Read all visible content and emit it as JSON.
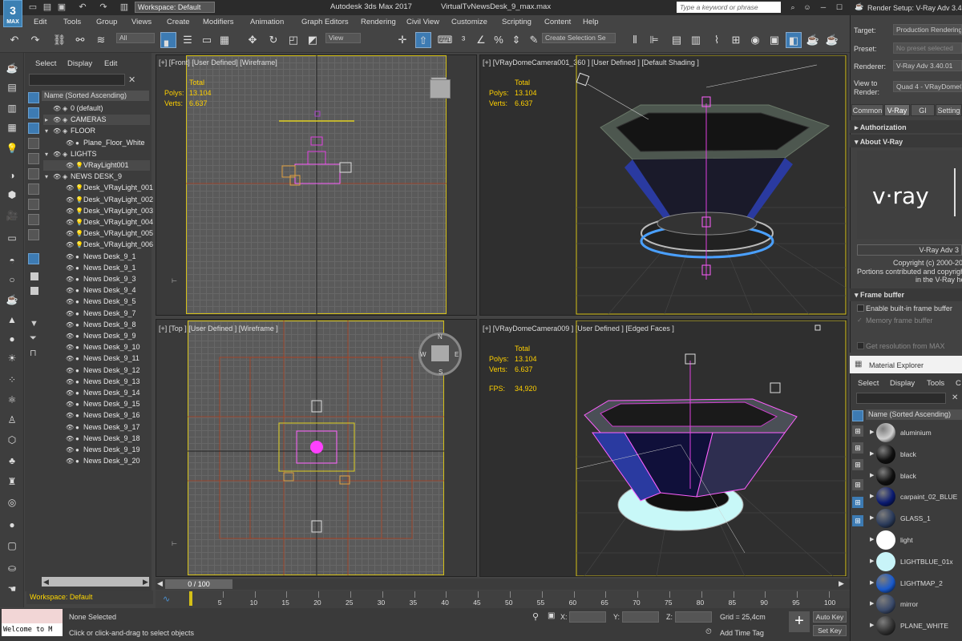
{
  "app": {
    "title": "Autodesk 3ds Max 2017",
    "file": "VirtualTvNewsDesk_9_max.max",
    "logo": "3",
    "logo_sub": "MAX",
    "workspace": "Workspace: Default",
    "search_placeholder": "Type a keyword or phrase"
  },
  "menu": [
    "Edit",
    "Tools",
    "Group",
    "Views",
    "Create",
    "Modifiers",
    "Animation",
    "Graph Editors",
    "Rendering",
    "Civil View",
    "Customize",
    "Scripting",
    "Content",
    "Help"
  ],
  "toolbar": {
    "filter": "All",
    "view": "View",
    "selection_set": "Create Selection Se"
  },
  "scene_explorer": {
    "tabs": [
      "Select",
      "Display",
      "Edit"
    ],
    "header": "Name (Sorted Ascending)",
    "rows": [
      {
        "label": "0 (default)",
        "indent": 1,
        "group": false,
        "icon": "layer"
      },
      {
        "label": "CAMERAS",
        "indent": 1,
        "group": true,
        "icon": "layer"
      },
      {
        "label": "FLOOR",
        "indent": 1,
        "group": false,
        "icon": "layer"
      },
      {
        "label": "Plane_Floor_White",
        "indent": 2,
        "group": false,
        "icon": "obj"
      },
      {
        "label": "LIGHTS",
        "indent": 1,
        "group": false,
        "icon": "layer"
      },
      {
        "label": "VRayLight001",
        "indent": 2,
        "group": true,
        "icon": "light"
      },
      {
        "label": "NEWS DESK_9",
        "indent": 1,
        "group": false,
        "icon": "layer"
      },
      {
        "label": "Desk_VRayLight_001",
        "indent": 2,
        "group": false,
        "icon": "light"
      },
      {
        "label": "Desk_VRayLight_002",
        "indent": 2,
        "group": false,
        "icon": "light"
      },
      {
        "label": "Desk_VRayLight_003",
        "indent": 2,
        "group": false,
        "icon": "light"
      },
      {
        "label": "Desk_VRayLight_004",
        "indent": 2,
        "group": false,
        "icon": "light"
      },
      {
        "label": "Desk_VRayLight_005",
        "indent": 2,
        "group": false,
        "icon": "light"
      },
      {
        "label": "Desk_VRayLight_006",
        "indent": 2,
        "group": false,
        "icon": "light"
      },
      {
        "label": "News Desk_9_1",
        "indent": 2,
        "group": false,
        "icon": "obj"
      },
      {
        "label": "News Desk_9_1",
        "indent": 2,
        "group": false,
        "icon": "obj"
      },
      {
        "label": "News Desk_9_3",
        "indent": 2,
        "group": false,
        "icon": "obj"
      },
      {
        "label": "News Desk_9_4",
        "indent": 2,
        "group": false,
        "icon": "obj"
      },
      {
        "label": "News Desk_9_5",
        "indent": 2,
        "group": false,
        "icon": "obj"
      },
      {
        "label": "News Desk_9_7",
        "indent": 2,
        "group": false,
        "icon": "obj"
      },
      {
        "label": "News Desk_9_8",
        "indent": 2,
        "group": false,
        "icon": "obj"
      },
      {
        "label": "News Desk_9_9",
        "indent": 2,
        "group": false,
        "icon": "obj"
      },
      {
        "label": "News Desk_9_10",
        "indent": 2,
        "group": false,
        "icon": "obj"
      },
      {
        "label": "News Desk_9_11",
        "indent": 2,
        "group": false,
        "icon": "obj"
      },
      {
        "label": "News Desk_9_12",
        "indent": 2,
        "group": false,
        "icon": "obj"
      },
      {
        "label": "News Desk_9_13",
        "indent": 2,
        "group": false,
        "icon": "obj"
      },
      {
        "label": "News Desk_9_14",
        "indent": 2,
        "group": false,
        "icon": "obj"
      },
      {
        "label": "News Desk_9_15",
        "indent": 2,
        "group": false,
        "icon": "obj"
      },
      {
        "label": "News Desk_9_16",
        "indent": 2,
        "group": false,
        "icon": "obj"
      },
      {
        "label": "News Desk_9_17",
        "indent": 2,
        "group": false,
        "icon": "obj"
      },
      {
        "label": "News Desk_9_18",
        "indent": 2,
        "group": false,
        "icon": "obj"
      },
      {
        "label": "News Desk_9_19",
        "indent": 2,
        "group": false,
        "icon": "obj"
      },
      {
        "label": "News Desk_9_20",
        "indent": 2,
        "group": false,
        "icon": "obj"
      }
    ],
    "workspace": "Workspace: Default"
  },
  "viewports": {
    "front": {
      "label": "[+] [Front] [User Defined] [Wireframe]",
      "total": "Total",
      "polys_label": "Polys:",
      "polys": "13.104",
      "verts_label": "Verts:",
      "verts": "6.637"
    },
    "cam360": {
      "label": "[+] [VRayDomeCamera001_360 ] [User Defined ] [Default Shading ]",
      "total": "Total",
      "polys_label": "Polys:",
      "polys": "13.104",
      "verts_label": "Verts:",
      "verts": "6.637"
    },
    "top": {
      "label": "[+] [Top ] [User Defined ] [Wireframe ]",
      "compass_n": "N",
      "compass_s": "S",
      "compass_w": "W",
      "compass_e": "E"
    },
    "cam009": {
      "label": "[+] [VRayDomeCamera009 ] [User Defined ] [Edged Faces ]",
      "total": "Total",
      "polys_label": "Polys:",
      "polys": "13.104",
      "verts_label": "Verts:",
      "verts": "6.637",
      "fps_label": "FPS:",
      "fps": "34,920"
    }
  },
  "timeline": {
    "frame": "0 / 100",
    "ticks": [
      "0",
      "5",
      "10",
      "15",
      "20",
      "25",
      "30",
      "35",
      "40",
      "45",
      "50",
      "55",
      "60",
      "65",
      "70",
      "75",
      "80",
      "85",
      "90",
      "95",
      "100"
    ]
  },
  "status": {
    "listener": "Welcome to M",
    "selection": "None Selected",
    "hint": "Click or click-and-drag to select objects",
    "x_label": "X:",
    "y_label": "Y:",
    "z_label": "Z:",
    "grid": "Grid = 25,4cm",
    "add_time_tag": "Add Time Tag",
    "auto_key": "Auto Key",
    "set_key": "Set Key"
  },
  "render_setup": {
    "title": "Render Setup: V-Ray Adv 3.4",
    "target_label": "Target:",
    "target": "Production Rendering",
    "preset_label": "Preset:",
    "preset": "No preset selected",
    "renderer_label": "Renderer:",
    "renderer": "V-Ray Adv 3.40.01",
    "view_label": "View to",
    "view_label2": "Render:",
    "view": "Quad 4 - VRayDomeC",
    "tabs": [
      "Common",
      "V-Ray",
      "GI",
      "Setting"
    ],
    "authorization": "Authorization",
    "about": "About V-Ray",
    "vray_logo": "v·ray",
    "version_box": "V-Ray Adv 3",
    "copyright": "Copyright (c) 2000-20",
    "portions": "Portions contributed and copyright",
    "vrayhe": "in the V-Ray he",
    "frame_buffer": "Frame buffer",
    "enable_fb": "Enable built-in frame buffer",
    "memory_fb": "Memory frame buffer",
    "get_res": "Get resolution from MAX"
  },
  "material_explorer": {
    "title": "Material Explorer",
    "tabs": [
      "Select",
      "Display",
      "Tools",
      "C"
    ],
    "header": "Name (Sorted Ascending)",
    "materials": [
      {
        "name": "aluminium",
        "color": "#cfcfcf"
      },
      {
        "name": "black",
        "color": "#101010"
      },
      {
        "name": "black",
        "color": "#101010"
      },
      {
        "name": "carpaint_02_BLUE",
        "color": "#0a1a70"
      },
      {
        "name": "GLASS_1",
        "color": "#2a3a5a"
      },
      {
        "name": "light",
        "color": "#ffffff"
      },
      {
        "name": "LIGHTBLUE_01x",
        "color": "#c8f4f8"
      },
      {
        "name": "LIGHTMAP_2",
        "color": "#1a5acc"
      },
      {
        "name": "mirror",
        "color": "#3a4a6a"
      },
      {
        "name": "PLANE_WHITE",
        "color": "#303030"
      }
    ]
  }
}
